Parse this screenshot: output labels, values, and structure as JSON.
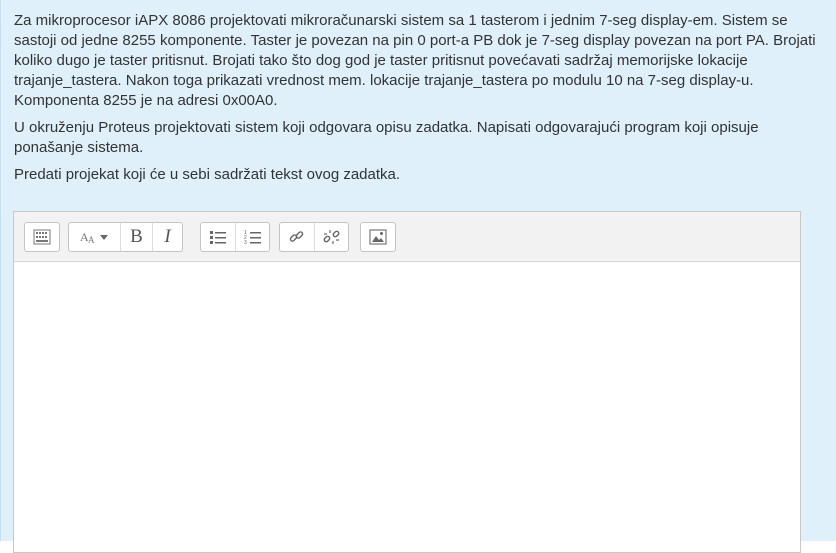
{
  "question": {
    "paragraph1": "Za mikroprocesor iAPX 8086 projektovati mikroračunarski sistem sa 1 tasterom i jednim 7-seg display-em. Sistem se sastoji od jedne 8255 komponente. Taster je povezan na pin 0 port-a PB dok je 7-seg display povezan na port PA. Brojati koliko dugo je taster pritisnut. Brojati tako što dog god je taster pritisnut povećavati sadržaj memorijske lokacije trajanje_tastera. Nakon toga prikazati vrednost mem. lokacije trajanje_tastera po modulu 10 na 7-seg display-u. Komponenta 8255 je na adresi 0x00A0.",
    "paragraph2": "U okruženju Proteus projektovati sistem koji odgovara opisu zadatka. Napisati odgovarajući program koji opisuje ponašanje sistema.",
    "paragraph3": "Predati projekat koji će u sebi sadržati tekst ovog zadatka."
  },
  "editor": {
    "toolbar": {
      "toggle_icon": "toolbar-toggle-icon",
      "font_style_icon": "font-style-icon",
      "bold_label": "B",
      "italic_label": "I",
      "unordered_list_icon": "unordered-list-icon",
      "ordered_list_icon": "ordered-list-icon",
      "link_icon": "link-icon",
      "unlink_icon": "unlink-icon",
      "image_icon": "image-icon"
    },
    "content": ""
  },
  "colors": {
    "panel_background": "#dff0fa",
    "text": "#333333",
    "toolbar_background": "#f2f2f2",
    "icon": "#666666"
  }
}
